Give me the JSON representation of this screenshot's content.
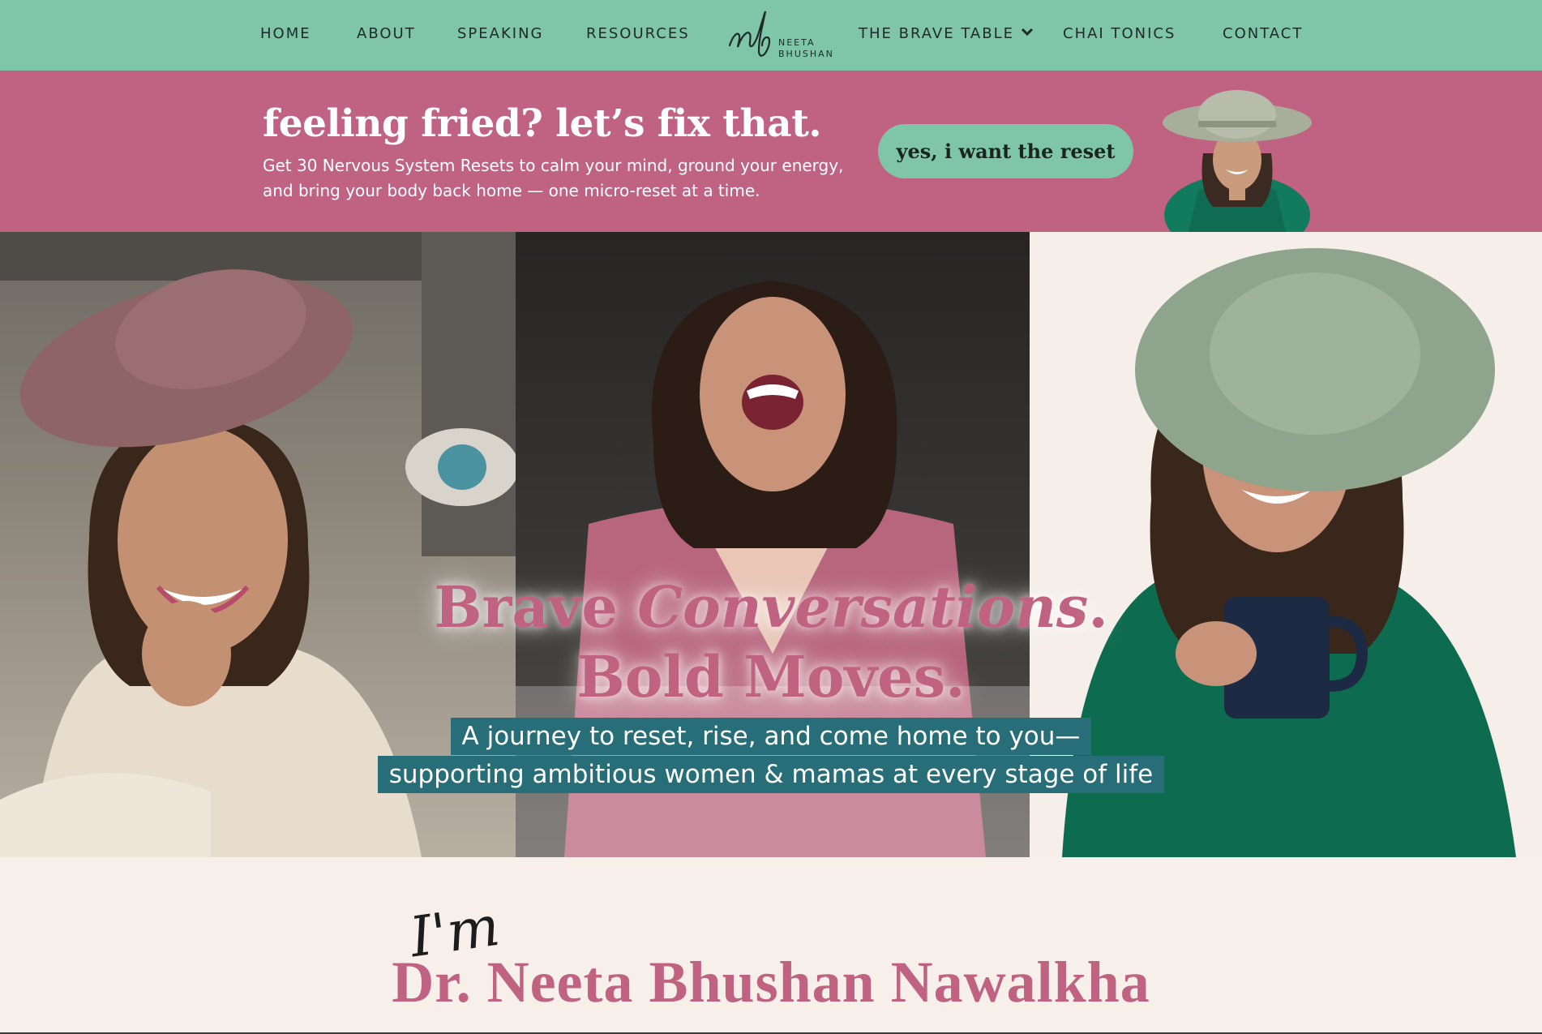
{
  "nav": {
    "items": [
      {
        "label": "HOME"
      },
      {
        "label": "ABOUT"
      },
      {
        "label": "SPEAKING"
      },
      {
        "label": "RESOURCES"
      },
      {
        "label": "THE BRAVE TABLE"
      },
      {
        "label": "CHAI TONICS"
      },
      {
        "label": "CONTACT"
      }
    ],
    "logo": {
      "monogram": "nb",
      "line1": "NEETA",
      "line2": "BHUSHAN"
    },
    "dropdown_icon": "chevron-down-icon"
  },
  "promo": {
    "title": "feeling fried? let’s fix that.",
    "subtitle": "Get 30 Nervous System Resets to calm your mind, ground your energy, and bring your body back home — one micro-reset at a time.",
    "cta_label": "yes, i want the reset"
  },
  "hero": {
    "heading_part1": "Brave ",
    "heading_italic": "Conversations",
    "heading_part2": ".",
    "heading_line2": "Bold Moves.",
    "subtitle_line1": "A journey to reset, rise, and come home to you—",
    "subtitle_line2": "supporting ambitious women & mamas at every stage of life"
  },
  "intro": {
    "im": "I'm",
    "name": "Dr. Neeta Bhushan Nawalkha"
  },
  "colors": {
    "nav_bg": "#7fc6a8",
    "promo_bg": "#c06282",
    "accent_pink": "#c06282",
    "teal_highlight": "#276e78",
    "page_bg": "#f6efea"
  }
}
